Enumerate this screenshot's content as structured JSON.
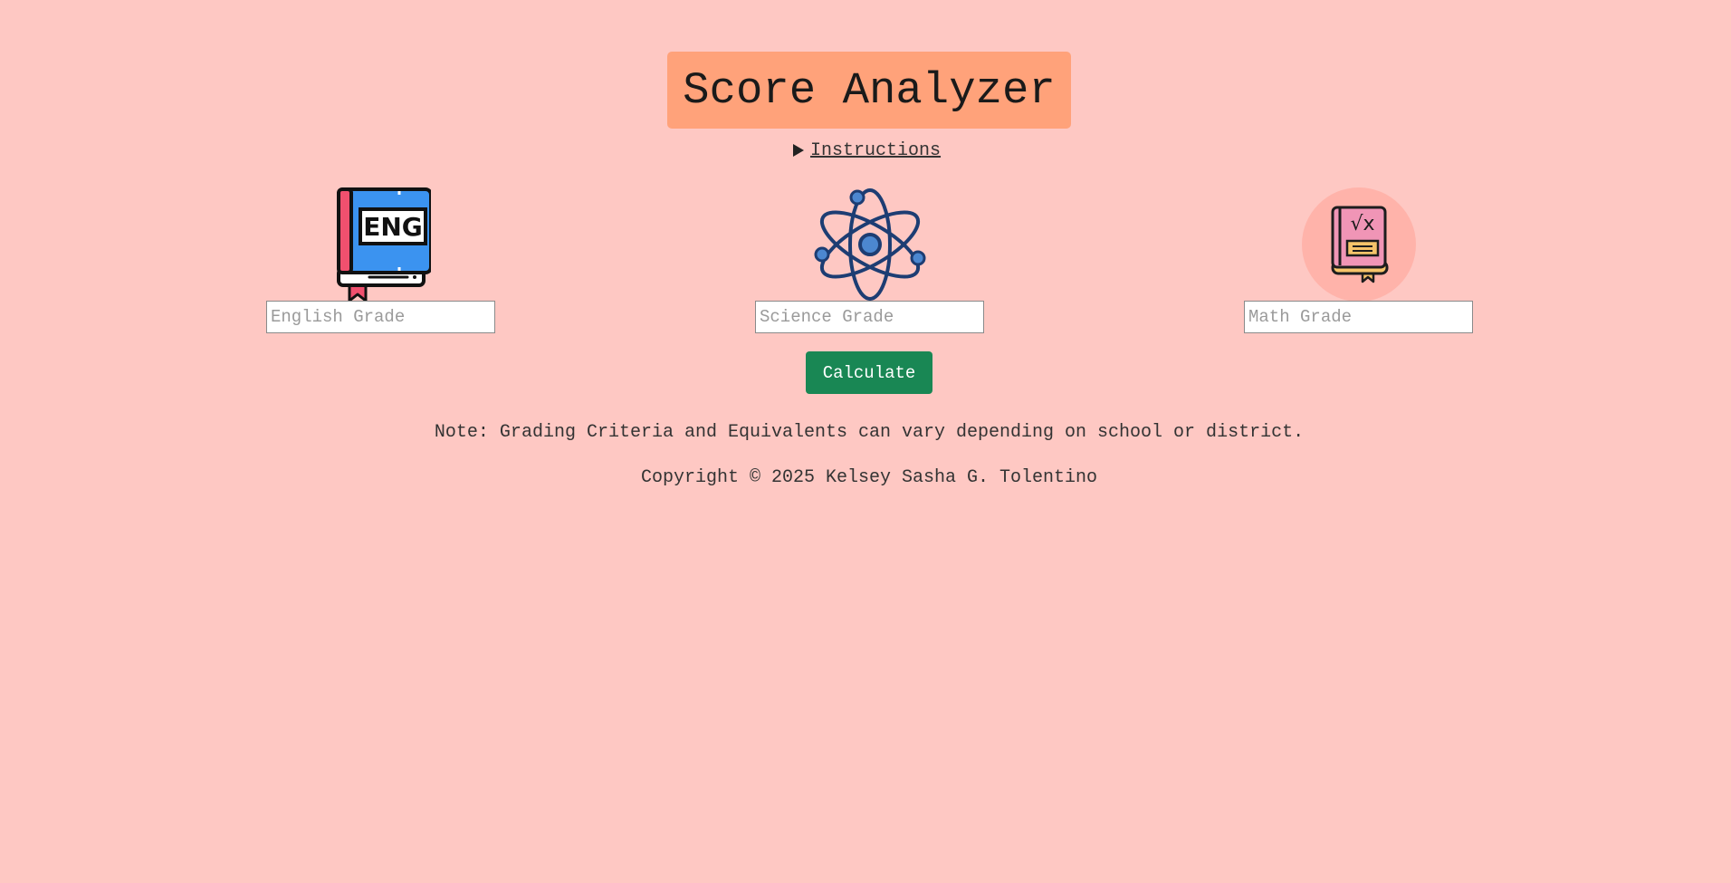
{
  "header": {
    "title": "Score Analyzer"
  },
  "instructions": {
    "label": "Instructions"
  },
  "subjects": [
    {
      "icon": "english-book-icon",
      "placeholder": "English Grade",
      "icon_text": "ENG"
    },
    {
      "icon": "atom-icon",
      "placeholder": "Science Grade"
    },
    {
      "icon": "math-book-icon",
      "placeholder": "Math Grade",
      "icon_text": "√x"
    }
  ],
  "actions": {
    "calculate_label": "Calculate"
  },
  "footer": {
    "note": "Note: Grading Criteria and Equivalents can vary depending on school or district.",
    "copyright": "Copyright © 2025 Kelsey Sasha G. Tolentino"
  },
  "colors": {
    "background": "#fec8c3",
    "title_bg": "#ffa27a",
    "button_bg": "#198754"
  }
}
